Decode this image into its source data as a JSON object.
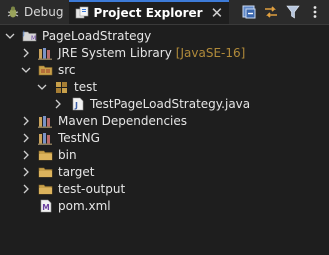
{
  "tabs": [
    {
      "label": "Debug",
      "active": false
    },
    {
      "label": "Project Explorer",
      "active": true
    }
  ],
  "tab_close": "✕",
  "tree": {
    "project": "PageLoadStrategy",
    "jre_library": "JRE System Library",
    "jre_version": "[JavaSE-16]",
    "src": "src",
    "package": "test",
    "java_file": "TestPageLoadStrategy.java",
    "maven": "Maven Dependencies",
    "testng": "TestNG",
    "bin": "bin",
    "target": "target",
    "test_output": "test-output",
    "pom": "pom.xml"
  },
  "colors": {
    "accent": "#3d7bd8",
    "folder": "#c8a04a",
    "muted_text": "#b08a3a"
  },
  "icons": {
    "debug": "bug-icon",
    "explorer": "project-explorer-icon",
    "collapse": "collapse-all-icon",
    "link": "link-with-editor-icon",
    "filter": "filter-icon",
    "menu": "view-menu-icon"
  }
}
